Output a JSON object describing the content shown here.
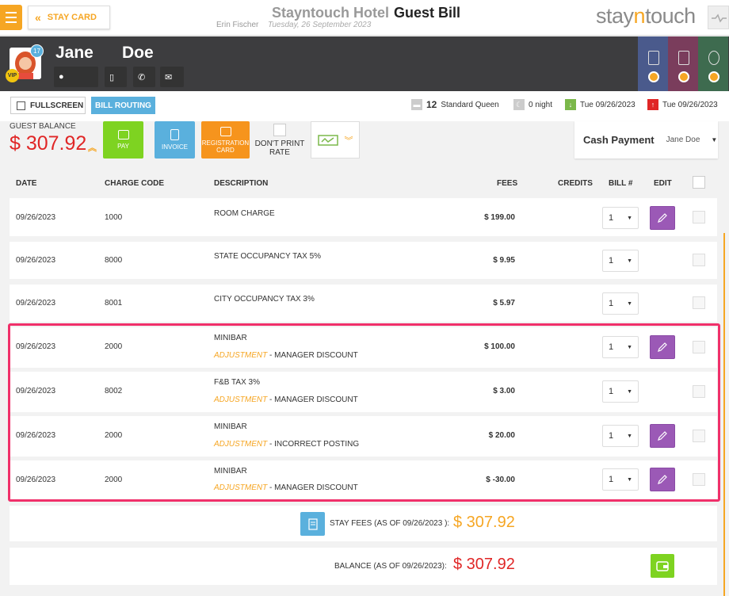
{
  "topbar": {
    "stay_card_label": "STAY CARD",
    "hotel_name": "Stayntouch Hotel",
    "bill_title": "Guest Bill",
    "user_name": "Erin Fischer",
    "business_date": "Tuesday, 26 September 2023",
    "logo_prefix": "stay",
    "logo_mid": "n",
    "logo_suffix": "touch"
  },
  "guest": {
    "first_name": "Jane",
    "last_name": "Doe",
    "vip": "VIP",
    "count": "17"
  },
  "toolbar": {
    "fullscreen": "FULLSCREEN",
    "bill_routing": "BILL ROUTING",
    "room_number": "12",
    "room_type": "Standard Queen",
    "nights": "0 night",
    "arrival": "Tue 09/26/2023",
    "departure": "Tue 09/26/2023"
  },
  "balance": {
    "label": "GUEST BALANCE",
    "amount": "$ 307.92"
  },
  "actions": {
    "pay": "PAY",
    "invoice": "INVOICE",
    "registration_card": "REGISTRATION CARD",
    "dont_print_rate": "DON'T PRINT RATE"
  },
  "payment": {
    "method": "Cash Payment",
    "guest": "Jane Doe"
  },
  "table": {
    "headers": {
      "date": "DATE",
      "charge_code": "CHARGE CODE",
      "description": "DESCRIPTION",
      "fees": "FEES",
      "credits": "CREDITS",
      "bill": "BILL #",
      "edit": "EDIT"
    },
    "rows": [
      {
        "date": "09/26/2023",
        "code": "1000",
        "desc": "ROOM CHARGE",
        "adj_label": "",
        "adj_text": "",
        "fee": "$ 199.00",
        "bill": "1"
      },
      {
        "date": "09/26/2023",
        "code": "8000",
        "desc": "STATE OCCUPANCY TAX 5%",
        "adj_label": "",
        "adj_text": "",
        "fee": "$ 9.95",
        "bill": "1"
      },
      {
        "date": "09/26/2023",
        "code": "8001",
        "desc": "CITY OCCUPANCY TAX 3%",
        "adj_label": "",
        "adj_text": "",
        "fee": "$ 5.97",
        "bill": "1"
      },
      {
        "date": "09/26/2023",
        "code": "2000",
        "desc": "MINIBAR",
        "adj_label": "ADJUSTMENT",
        "adj_text": " - MANAGER DISCOUNT",
        "fee": "$ 100.00",
        "bill": "1"
      },
      {
        "date": "09/26/2023",
        "code": "8002",
        "desc": "F&B TAX 3%",
        "adj_label": "ADJUSTMENT",
        "adj_text": " - MANAGER DISCOUNT",
        "fee": "$ 3.00",
        "bill": "1"
      },
      {
        "date": "09/26/2023",
        "code": "2000",
        "desc": "MINIBAR",
        "adj_label": "ADJUSTMENT",
        "adj_text": " - INCORRECT POSTING",
        "fee": "$ 20.00",
        "bill": "1"
      },
      {
        "date": "09/26/2023",
        "code": "2000",
        "desc": "MINIBAR",
        "adj_label": "ADJUSTMENT",
        "adj_text": " - MANAGER DISCOUNT",
        "fee": "$ -30.00",
        "bill": "1"
      }
    ]
  },
  "totals": {
    "stay_fees_label": "STAY FEES (AS OF  09/26/2023 ):",
    "stay_fees_amount": "$ 307.92",
    "balance_label": "BALANCE (AS OF  09/26/2023):",
    "balance_amount": "$ 307.92"
  },
  "colors": {
    "accent": "#f6a623",
    "balance_red": "#e02626",
    "edit_purple": "#9b59b6",
    "pay_green": "#7ed321",
    "invoice_blue": "#5ab0dd",
    "highlight": "#f0306a"
  }
}
